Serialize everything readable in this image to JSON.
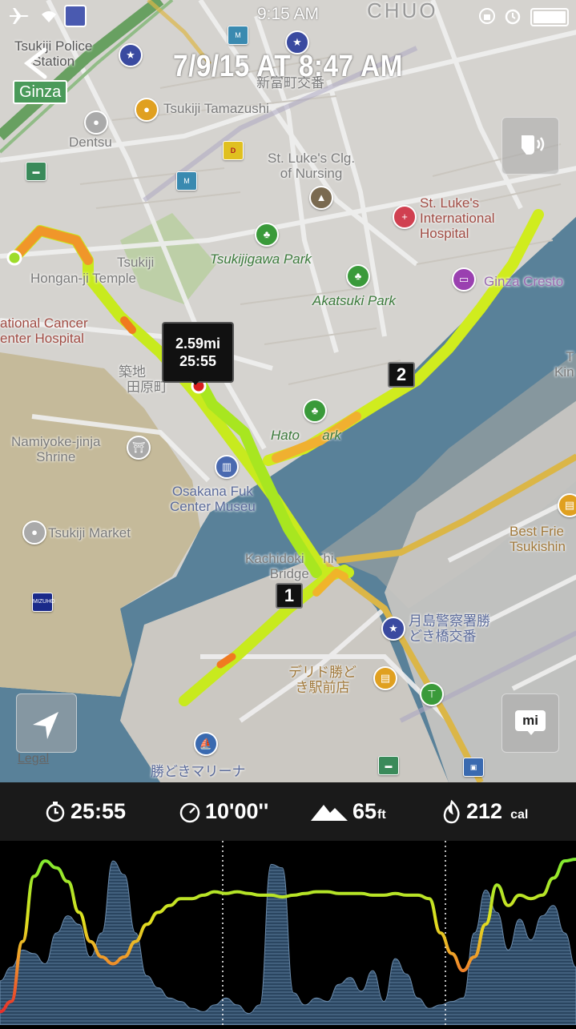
{
  "status_bar": {
    "time": "9:15 AM",
    "left_icons": [
      "airplane-icon",
      "wifi-icon",
      "police-box-icon"
    ],
    "right_icons": [
      "orientation-lock-icon",
      "alarm-icon",
      "battery-icon"
    ]
  },
  "header": {
    "title": "7/9/15 AT 8:47 AM",
    "back_icon": "chevron-left-icon"
  },
  "map": {
    "labels": {
      "chuo": "CHUO",
      "police_station": "Tsukiji Police\nStation",
      "ginza": "Ginza",
      "koban": "新富町交番",
      "tamazushi": "Tsukiji Tamazushi",
      "dentsu": "Dentsu",
      "dennys": "Denny's",
      "st_lukes_college": "St. Luke's Clg.\nof Nursing",
      "st_lukes_hospital": "St. Luke's\nInternational\nHospital",
      "tsukiji": "Tsukiji",
      "hongan_temple": "Hongan-ji Temple",
      "tsukijigawa_park": "Tsukijigawa Park",
      "akatsuki_park": "Akatsuki Park",
      "cancer_center": "ational Cancer\nenter Hospital",
      "ginza_cresto": "Ginza Cresto",
      "tsukiji_jp": "築地",
      "tawaracho": "田原町",
      "namiyoke": "Namiyoke-jinja\nShrine",
      "hatoba_park": "Hato      ark",
      "osakana": "Osakana Fuk\nCenter Museu",
      "tsukiji_market": "Tsukiji Market",
      "kachidoki_bridge": "Kachidoki     hi\nBridge",
      "best_friend": "Best Frie\nTsukishin",
      "kin": "T\nKin",
      "mizuho": "MIZUHO",
      "tsukishima_police": "月島警察署勝\nどき橋交番",
      "dericious": "デリド勝ど\nき駅前店",
      "marina": "勝どきマリーナ",
      "legal": "Legal"
    },
    "route_tooltip": {
      "distance": "2.59mi",
      "time": "25:55"
    },
    "split_markers": [
      "1",
      "2"
    ],
    "buttons": {
      "audio": "audio-feedback-icon",
      "locate": "location-arrow-icon",
      "units": "mi"
    }
  },
  "stats": {
    "duration": "25:55",
    "pace": "10'00''",
    "elevation_value": "65",
    "elevation_unit": "ft",
    "calories_value": "212",
    "calories_unit": "cal",
    "icons": [
      "stopwatch-icon",
      "pace-gauge-icon",
      "mountain-icon",
      "flame-icon"
    ]
  },
  "colors": {
    "route_fast": "#c8f01e",
    "route_mid": "#f0c830",
    "route_slow": "#f07820",
    "water": "#5f8aa3",
    "elevation_fill": "#3a5a7a"
  },
  "graph": {
    "pace_curve": [
      0.04,
      0.1,
      0.45,
      0.83,
      0.92,
      0.88,
      0.8,
      0.62,
      0.45,
      0.36,
      0.32,
      0.36,
      0.45,
      0.55,
      0.62,
      0.66,
      0.7,
      0.7,
      0.72,
      0.74,
      0.73,
      0.74,
      0.73,
      0.72,
      0.72,
      0.71,
      0.72,
      0.73,
      0.74,
      0.74,
      0.73,
      0.73,
      0.73,
      0.72,
      0.72,
      0.73,
      0.72,
      0.72,
      0.7,
      0.5,
      0.38,
      0.28,
      0.36,
      0.55,
      0.78,
      0.66,
      0.72,
      0.7,
      0.72,
      0.82,
      0.92,
      0.93
    ],
    "elevation_curve": [
      0.22,
      0.3,
      0.4,
      0.38,
      0.32,
      0.5,
      0.6,
      0.55,
      0.36,
      0.5,
      0.92,
      0.84,
      0.5,
      0.25,
      0.18,
      0.12,
      0.1,
      0.06,
      0.04,
      0.08,
      0.12,
      0.08,
      0.03,
      0.08,
      0.9,
      0.88,
      0.15,
      0.08,
      0.12,
      0.1,
      0.2,
      0.24,
      0.16,
      0.28,
      0.1,
      0.35,
      0.26,
      0.12,
      0.06,
      0.08,
      0.1,
      0.12,
      0.5,
      0.75,
      0.62,
      0.4,
      0.58,
      0.46,
      0.6,
      0.66,
      0.5,
      0.3
    ],
    "split_dividers": [
      1,
      2
    ]
  }
}
